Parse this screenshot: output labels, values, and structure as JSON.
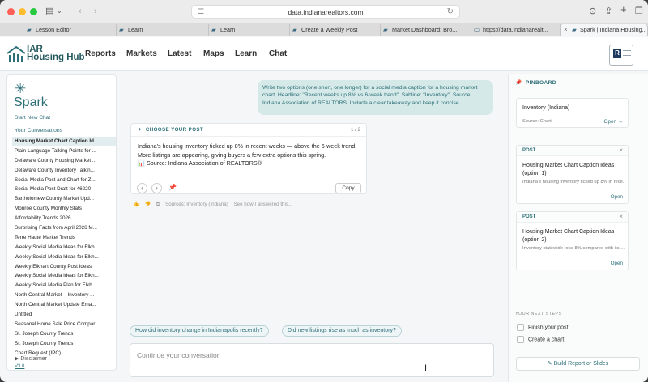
{
  "browser": {
    "url": "data.indianarealtors.com",
    "tabs": [
      {
        "label": "Lesson Editor",
        "active": false
      },
      {
        "label": "Learn",
        "active": false
      },
      {
        "label": "Learn",
        "active": false
      },
      {
        "label": "Create a Weekly Post",
        "active": false
      },
      {
        "label": "Market Dashboard: Bro...",
        "active": false
      },
      {
        "label": "https://data.indianarealt...",
        "active": false
      },
      {
        "label": "Spark | Indiana Housing...",
        "active": true
      }
    ]
  },
  "app": {
    "logo_line1": "IAR",
    "logo_line2": "Housing Hub",
    "nav": [
      "Reports",
      "Markets",
      "Latest",
      "Maps",
      "Learn",
      "Chat"
    ]
  },
  "sidebar": {
    "title": "Spark",
    "new_chat": "Start New Chat",
    "conversations_heading": "Your Conversations",
    "conversations": [
      "Housing Market Chart Caption Id...",
      "Plain-Language Talking Points for ...",
      "Delaware County Housing Market ...",
      "Delaware County Inventory Talkin...",
      "Social Media Post and Chart for ZI...",
      "Social Media Post Draft for 46220",
      "Bartholomew County Market Upd...",
      "Monroe County Monthly Stats",
      "Affordability Trends 2026",
      "Surprising Facts from April 2026 M...",
      "Terre Haute Market Trends",
      "Weekly Social Media Ideas for Elkh...",
      "Weekly Social Media Ideas for Elkh...",
      "Weekly Elkhart County Post Ideas",
      "Weekly Social Media Ideas for Elkh...",
      "Weekly Social Media Plan for Elkh...",
      "North Central Market – Inventory ...",
      "North Central Market Update Ema...",
      "Untitled",
      "Seasonal Home Sale Price Compar...",
      "St. Joseph County Trends",
      "St. Joseph County Trends",
      "Chart Request (IPC)"
    ],
    "disclaimer": "Disclaimer",
    "version": "V3.0"
  },
  "chat": {
    "user_message": "Write two options (one short, one longer) for a social media caption for a housing market chart. Headline: \"Recent weeks up 8% vs 6-week trend\". Subline: \"Inventory\". Source: Indiana Association of REALTORS. Include a clear takeaway and keep it concise.",
    "post_card": {
      "label": "CHOOSE YOUR POST",
      "pager": "1 / 2",
      "line1": "Indiana's housing inventory ticked up 8% in recent weeks — above the 6-week trend.",
      "line2": "More listings are appearing, giving buyers a few extra options this spring.",
      "line3": "📊 Source: Indiana Association of REALTORS®",
      "copy": "Copy"
    },
    "sources": "Sources: Inventory (Indiana)",
    "how_answered": "See how I answered this...",
    "suggestions": [
      "How did inventory change in Indianapolis recently?",
      "Did new listings rise as much as inventory?"
    ],
    "input_placeholder": "Continue your conversation"
  },
  "pinboard": {
    "heading": "PINBOARD",
    "chart_card": {
      "title": "Inventory (Indiana)",
      "source": "Source: Chart",
      "open": "Open →"
    },
    "post_cards": [
      {
        "tag": "POST",
        "title": "Housing Market Chart Caption Ideas (option 1)",
        "preview": "Indiana's housing inventory ticked up 8% in rece...",
        "open": "Open"
      },
      {
        "tag": "POST",
        "title": "Housing Market Chart Caption Ideas (option 2)",
        "preview": "Inventory statewide rose 8% compared with its ...",
        "open": "Open"
      }
    ],
    "next_steps_heading": "YOUR NEXT STEPS",
    "next_steps": [
      "Finish your post",
      "Create a chart"
    ],
    "build_button": "Build Report or Slides"
  },
  "colors": {
    "brand": "#2d6f78",
    "bubble": "#d5e9e8",
    "accent_red": "#ff5f57"
  }
}
